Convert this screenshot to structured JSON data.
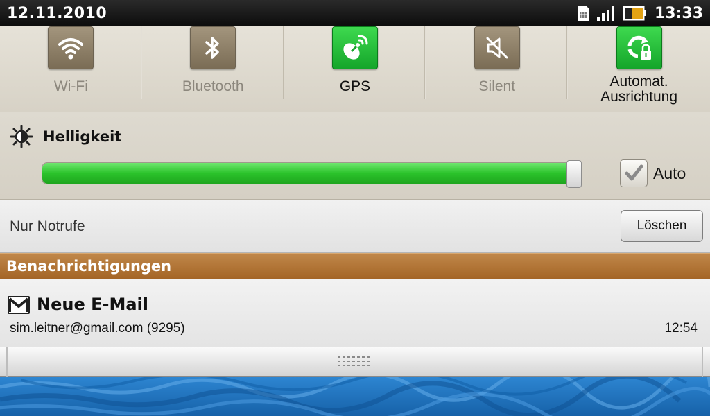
{
  "statusbar": {
    "date": "12.11.2010",
    "time": "13:33",
    "icons": [
      "sim-card-icon",
      "signal-strength-icon",
      "battery-icon"
    ]
  },
  "toggles": [
    {
      "label": "Wi-Fi",
      "icon": "wifi-icon",
      "state": "off"
    },
    {
      "label": "Bluetooth",
      "icon": "bluetooth-icon",
      "state": "off"
    },
    {
      "label": "GPS",
      "icon": "gps-icon",
      "state": "on"
    },
    {
      "label": "Silent",
      "icon": "speaker-muted-icon",
      "state": "off"
    },
    {
      "label_line1": "Automat.",
      "label_line2": "Ausrichtung",
      "icon": "auto-rotate-lock-icon",
      "state": "on"
    }
  ],
  "brightness": {
    "title": "Helligkeit",
    "icon": "brightness-sun-icon",
    "level": 1.0,
    "auto_label": "Auto",
    "auto_checked": true
  },
  "carrier": {
    "text": "Nur Notrufe",
    "clear_label": "Löschen"
  },
  "notifications": {
    "header": "Benachrichtigungen",
    "items": [
      {
        "icon": "gmail-icon",
        "title": "Neue E-Mail",
        "detail": "sim.leitner@gmail.com (9295)",
        "time": "12:54"
      }
    ]
  },
  "colors": {
    "toggle_on": "#1fb734",
    "toggle_off": "#8e8068",
    "slider": "#2bc32b",
    "header_bar": "#b0712f"
  }
}
